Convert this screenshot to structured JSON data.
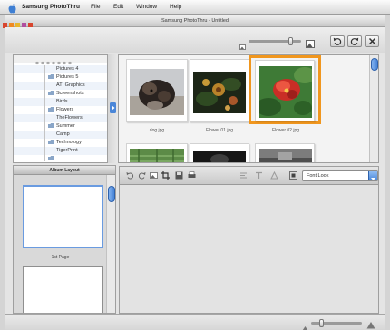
{
  "menubar": {
    "app_name": "Samsung PhotoThru",
    "items": [
      "File",
      "Edit",
      "Window",
      "Help"
    ]
  },
  "window": {
    "title": "Samsung PhotoThru - Untitled"
  },
  "colors": {
    "window_bg": "#e4e4e4",
    "accent_blue": "#4a86d8",
    "selection_highlight": "#f0961e"
  },
  "toolbar": {
    "thumbnail_size_level": 0.8,
    "buttons": [
      "rotate-left-icon",
      "rotate-right-icon",
      "delete-icon"
    ]
  },
  "folder_tree": {
    "items": [
      {
        "label": "Pictures 4"
      },
      {
        "label": "Pictures 5"
      },
      {
        "label": "ATI Graphics"
      },
      {
        "label": "Screenshots"
      },
      {
        "label": "Birds"
      },
      {
        "label": "Flowers"
      },
      {
        "label": "TheFlowers"
      },
      {
        "label": "Summer"
      },
      {
        "label": "Camp"
      },
      {
        "label": "Technology"
      },
      {
        "label": "TigerPrint"
      }
    ]
  },
  "thumbnails": {
    "items": [
      {
        "label": "dog.jpg",
        "icon": "dog-photo"
      },
      {
        "label": "Flower 01.jpg",
        "icon": "flowers-photo"
      },
      {
        "label": "Flower 02.jpg",
        "icon": "red-flower-photo",
        "selected": true
      }
    ]
  },
  "album_panel": {
    "header": "Album Layout",
    "pages": [
      {
        "label": "1st Page",
        "selected": true
      }
    ]
  },
  "editor": {
    "font_select": "Font Look",
    "tool_icons": [
      "undo-icon",
      "redo-icon",
      "insert-image-icon",
      "crop-icon",
      "save-icon",
      "print-icon",
      "align-icon",
      "text-icon",
      "color-icon",
      "frame-icon"
    ]
  },
  "status_bar": {
    "zoom_level": 0.2
  }
}
